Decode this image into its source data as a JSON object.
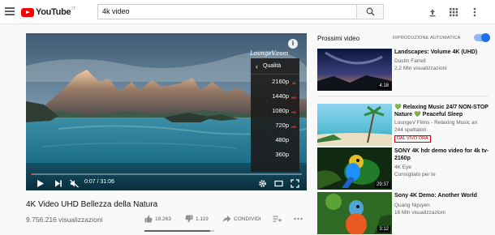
{
  "header": {
    "logo_text": "YouTube",
    "logo_country": "IT",
    "search_value": "4k video",
    "icons": [
      "hamburger-menu-icon",
      "search-icon",
      "upload-icon",
      "apps-grid-icon",
      "more-vert-icon"
    ]
  },
  "player": {
    "watermark": "LoungeV.com",
    "time": "0:07 / 31:06",
    "progress": 0.004,
    "quality_menu": {
      "title": "Qualità",
      "options": [
        {
          "label": "2160p",
          "badge": "4K"
        },
        {
          "label": "1440p",
          "badge": "HD"
        },
        {
          "label": "1080p",
          "badge": "HD"
        },
        {
          "label": "720p",
          "badge": "HD"
        },
        {
          "label": "480p",
          "badge": ""
        },
        {
          "label": "360p",
          "badge": ""
        }
      ]
    }
  },
  "video": {
    "title": "4K Video UHD Bellezza della Natura",
    "views": "9.756.216 visualizzazioni",
    "likes": "19.263",
    "dislikes": "1.119",
    "share_label": "CONDIVIDI",
    "like_ratio": 0.945
  },
  "sidebar": {
    "next_title": "Prossimi video",
    "autoplay_label": "RIPRODUZIONE AUTOMATICA",
    "autoplay_on": true,
    "items": [
      {
        "title": "Landscapes: Volume 4K (UHD)",
        "channel": "Dustin Farrell",
        "meta": "2,2 Mln visualizzazioni",
        "duration": "4:18",
        "live": ""
      },
      {
        "title": "💚 Relaxing Music 24/7 NON-STOP Nature 💚 Peaceful Sleep",
        "channel": "LoungeV Films - Relaxing Music an",
        "meta": "244 spettatori",
        "duration": "",
        "live": "DAL VIVO ORA"
      },
      {
        "title": "SONY 4K hdr demo video for 4k tv-2160p",
        "channel": "4K Eye",
        "meta": "Consigliato per te",
        "duration": "29:37",
        "live": ""
      },
      {
        "title": "Sony 4K Demo: Another World",
        "channel": "Quang Nguyen",
        "meta": "16 Mln visualizzazioni",
        "duration": "3:12",
        "live": ""
      }
    ]
  },
  "colors": {
    "brand": "#ff0000",
    "accent": "#1a73e8",
    "live": "#cc0000"
  }
}
